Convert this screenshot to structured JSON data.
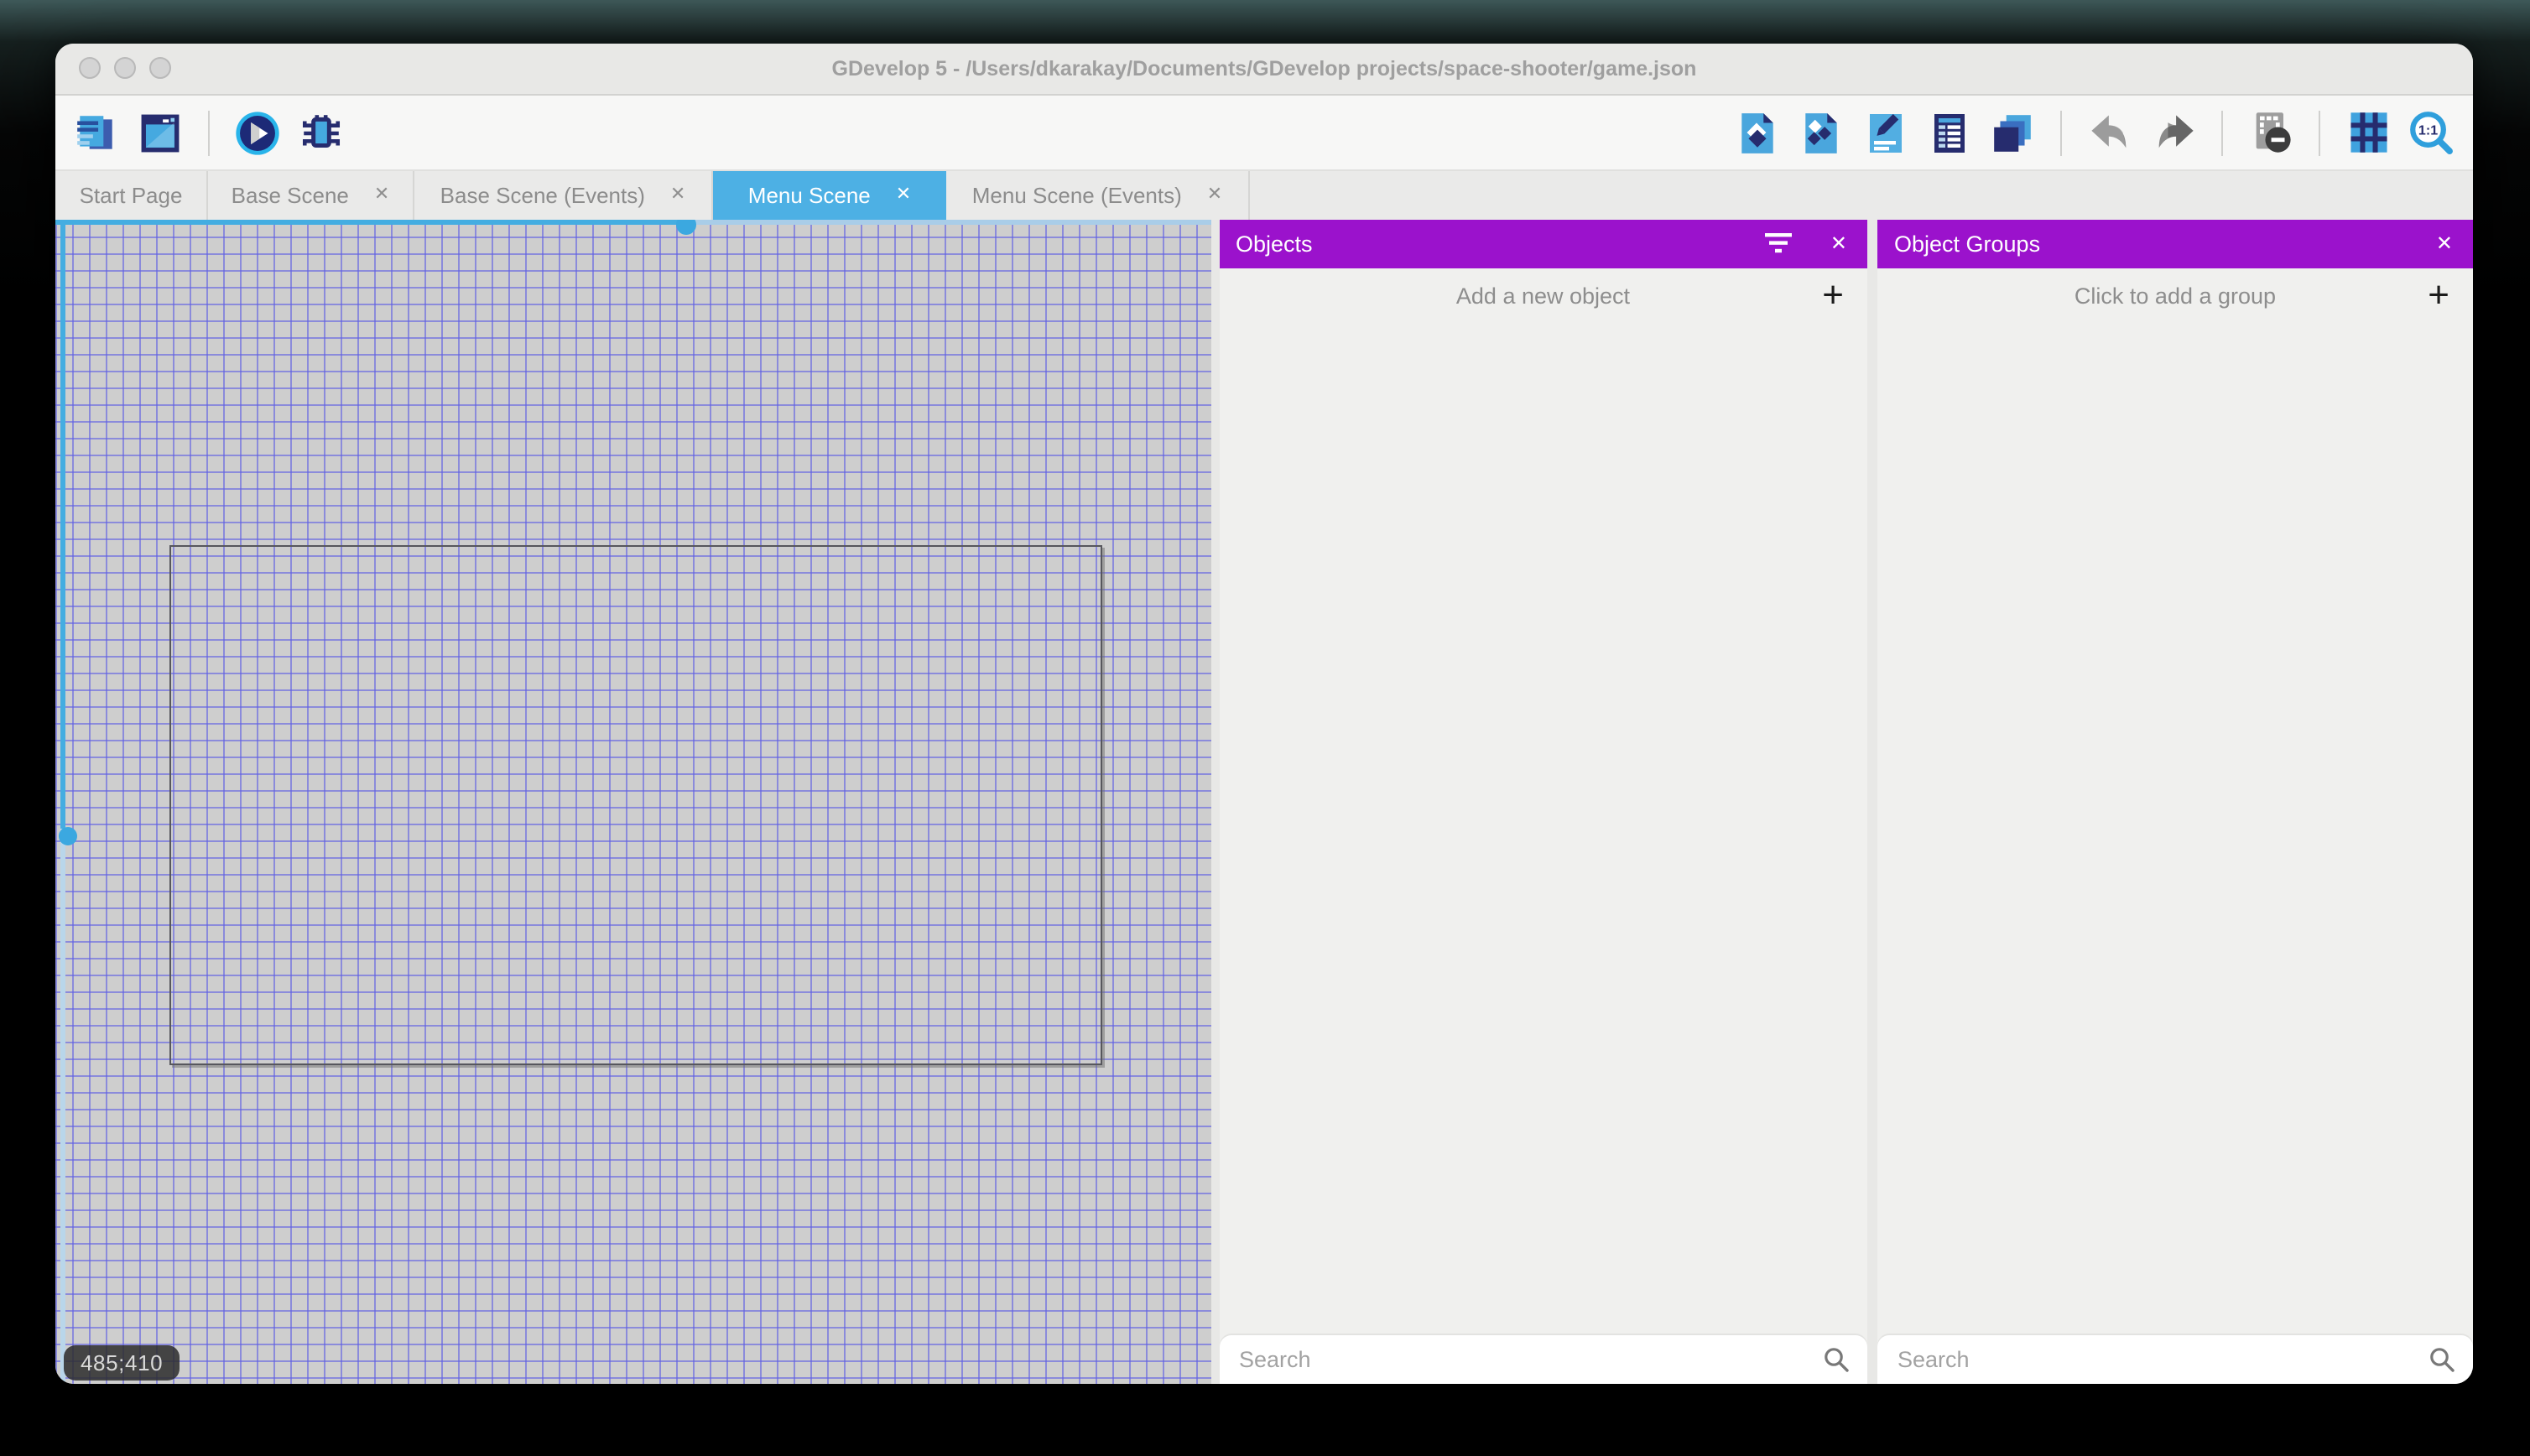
{
  "window": {
    "title": "GDevelop 5 - /Users/dkarakay/Documents/GDevelop projects/space-shooter/game.json",
    "traffic_lights": [
      "close",
      "minimize",
      "zoom"
    ]
  },
  "toolbar": {
    "left_icons": [
      "project-manager-icon",
      "start-page-icon",
      "preview-icon",
      "debug-icon"
    ],
    "right_icons": [
      "objects-editor-icon",
      "object-groups-editor-icon",
      "properties-icon",
      "instances-list-icon",
      "layers-editor-icon",
      "undo-icon",
      "redo-icon",
      "window-mask-icon",
      "grid-icon",
      "zoom-icon"
    ],
    "zoom_label": "1:1"
  },
  "tabs": [
    {
      "label": "Start Page",
      "closable": false,
      "active": false
    },
    {
      "label": "Base Scene",
      "closable": true,
      "active": false
    },
    {
      "label": "Base Scene (Events)",
      "closable": true,
      "active": false
    },
    {
      "label": "Menu Scene",
      "closable": true,
      "active": true
    },
    {
      "label": "Menu Scene (Events)",
      "closable": true,
      "active": false
    }
  ],
  "ui": {
    "close_symbol": "✕",
    "plus_symbol": "+"
  },
  "canvas": {
    "coordinate_badge": "485;410"
  },
  "objects_panel": {
    "title": "Objects",
    "add_label": "Add a new object",
    "search_placeholder": "Search"
  },
  "object_groups_panel": {
    "title": "Object Groups",
    "add_label": "Click to add a group",
    "search_placeholder": "Search"
  },
  "colors": {
    "panel_header_purple": "#9b12cc",
    "active_tab_blue": "#4db0e4",
    "scrollbar_blue": "#44ade1",
    "canvas_background": "#cecece",
    "grid_line": "#6a6ae0",
    "icon_navy": "#262c6e",
    "icon_light_blue": "#4aa6dd"
  }
}
